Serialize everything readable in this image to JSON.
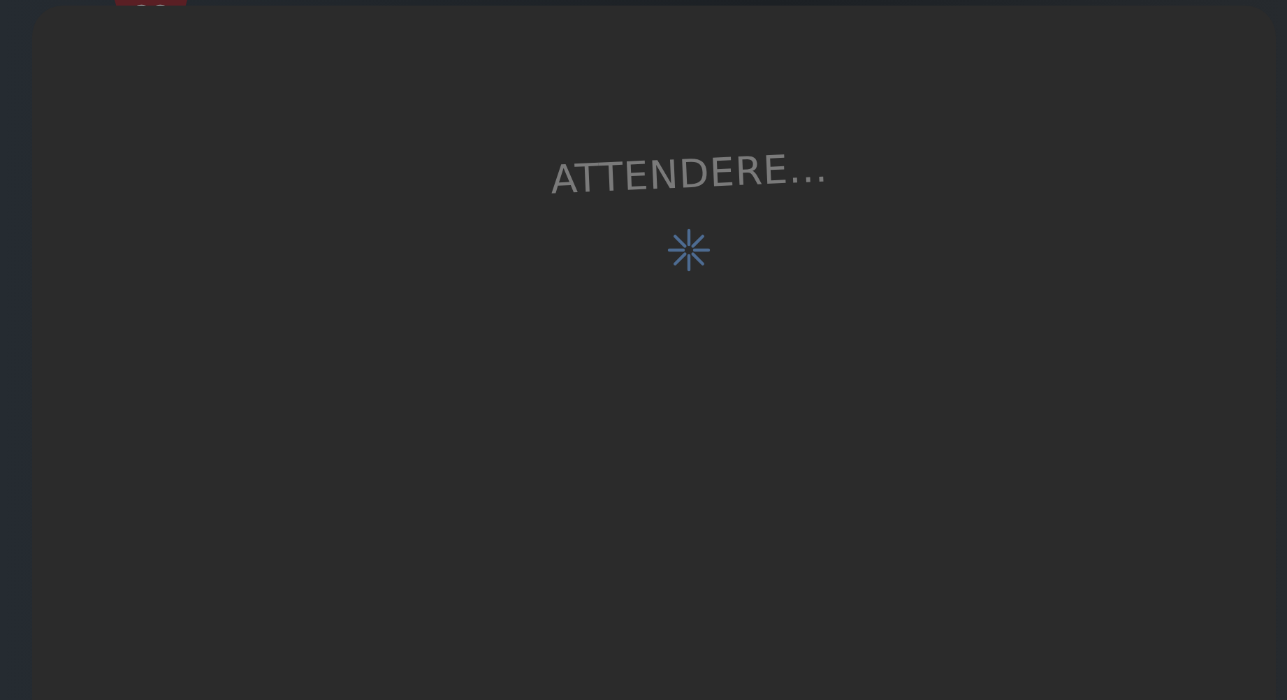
{
  "dialog": {
    "message": "ATTENDERE..."
  }
}
